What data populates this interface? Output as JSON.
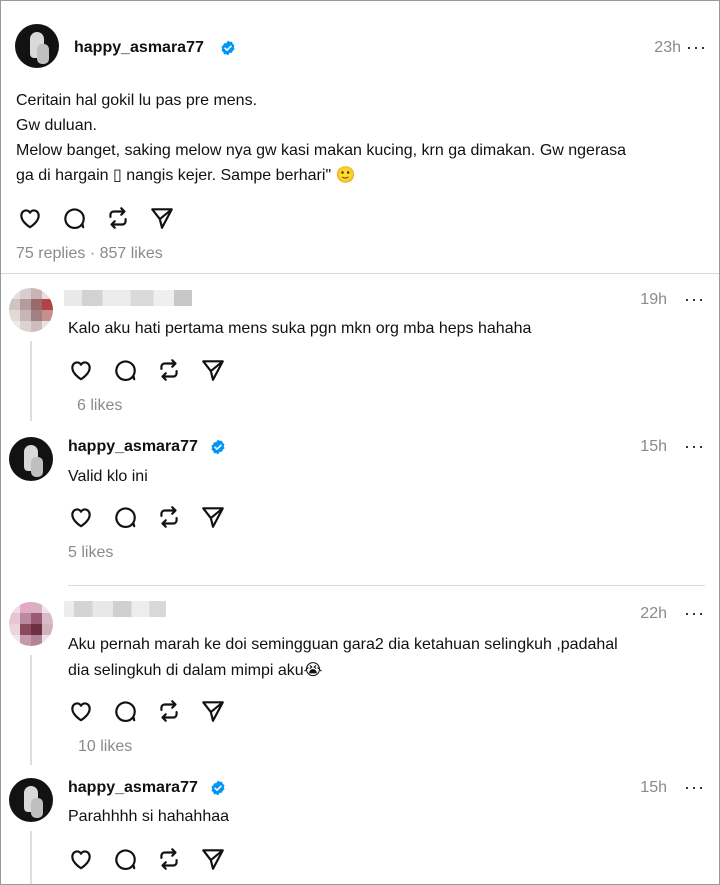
{
  "post": {
    "username": "happy_asmara77",
    "time": "23h",
    "more": "···",
    "lines": [
      "Ceritain hal gokil lu pas pre mens.",
      "Gw duluan.",
      "Melow banget, saking melow nya gw kasi makan kucing, krn ga dimakan. Gw ngerasa",
      "ga di hargain ▯ nangis kejer. Sampe berhari\" 🙂"
    ],
    "stats": "75 replies · 857 likes"
  },
  "replies": [
    {
      "username": "",
      "time": "19h",
      "more": "···",
      "text": "Kalo aku hati pertama mens suka pgn mkn org mba heps hahaha",
      "likes": "6 likes"
    },
    {
      "username": "happy_asmara77",
      "time": "15h",
      "more": "···",
      "text": "Valid klo ini",
      "likes": "5 likes"
    },
    {
      "username": "",
      "time": "22h",
      "more": "···",
      "text_line1": "Aku pernah marah ke doi semingguan gara2 dia ketahuan selingkuh ,padahal",
      "text_line2": "dia selingkuh di dalam mimpi aku😭",
      "likes": "10 likes"
    },
    {
      "username": "happy_asmara77",
      "time": "15h",
      "more": "···",
      "text": "Parahhhh si hahahhaa"
    }
  ],
  "icons": [
    "heart-icon",
    "comment-icon",
    "repost-icon",
    "share-icon",
    "verified-badge-icon",
    "more-icon"
  ],
  "colors": {
    "verified": "#0095f6",
    "muted": "#8a8a8a",
    "text": "#101010",
    "divider": "#d9d9d9"
  }
}
